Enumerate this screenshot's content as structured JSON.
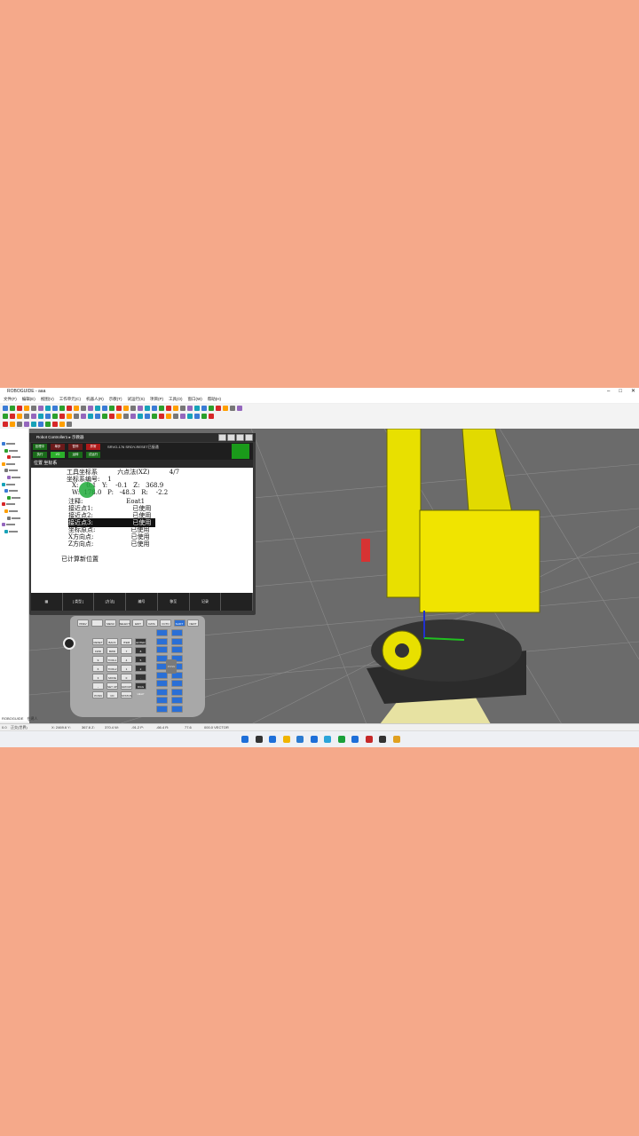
{
  "app": {
    "title": "ROBOGUIDE - aaa",
    "window_controls": [
      "–",
      "□",
      "✕"
    ]
  },
  "menu": [
    "文件(F)",
    "编辑(E)",
    "视图(V)",
    "工作单元(C)",
    "机器人(R)",
    "示教(T)",
    "试运行(S)",
    "项目(P)",
    "工具(O)",
    "窗口(W)",
    "帮助(H)"
  ],
  "pendant": {
    "header": "Robot Controller1 ▸ 示教器",
    "status_leds": [
      "处理中",
      "单步",
      "暂停",
      "异常",
      "执行",
      "I/O",
      "运转",
      "试运行"
    ],
    "message": "SRVO-176 SRDY-RESET已接通",
    "screen_title": "位置 坐标系",
    "lines": {
      "l1": "工具坐标系          六点法(XZ)          4/7",
      "l2": "坐标系编号:    1",
      "l3": "X:    0.1   Y:    -0.1   Z:   368.9",
      "l4": "W:  178.0   P:   -48.3   R:    -2.2",
      "l5": "注释:                      Eoat1",
      "l6": "接近点1:                    已使用",
      "l7": "接近点2:                    已使用",
      "l8": "接近点3:                    已使用",
      "l9": "坐标原点:                  已使用",
      "l10": "X方向点:                   已使用",
      "l11": "Z方向点:                   已使用",
      "l12": "已计算新位置"
    },
    "fkeys": [
      "[ 类型 ]",
      "[方法]",
      "编号",
      "移至",
      "记录"
    ]
  },
  "keypad": {
    "row1": [
      "PREV",
      "",
      "MENU",
      "SELECT",
      "EDIT",
      "DATA",
      "FCTN",
      "SHIFT",
      "NEXT"
    ],
    "keys": [
      "RESET",
      "BACK SPACE",
      "ITEM",
      "ENTER",
      "FWD",
      "BWD",
      "7",
      "8",
      "9",
      "TOOL1",
      "4",
      "5",
      "6",
      "TOOL2",
      "1",
      "2",
      "3",
      "MOVE MENU",
      "0",
      ".",
      "-",
      "SET UP",
      "GROUP",
      "DIAG HELP",
      "POSN",
      "I/O",
      "STATUS"
    ],
    "posn": "POSN"
  },
  "bottom": {
    "tabs": [
      "ROBOGUIDE",
      "在建人"
    ],
    "status": [
      "0.0",
      "正交(世界)",
      "X: 2469.6 Y:",
      "367.6 Z:",
      "370.4 W:",
      "-91.2 P:",
      "-66.4 R:",
      "77.6",
      "000.0 VECTOR"
    ]
  }
}
